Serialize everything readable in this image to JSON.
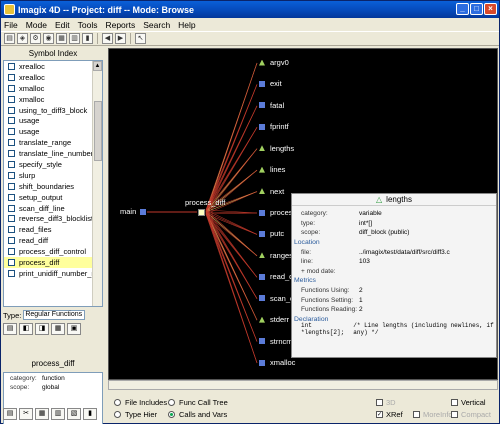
{
  "window": {
    "title": "Imagix 4D -- Project: diff -- Mode: Browse"
  },
  "menu": [
    "File",
    "Mode",
    "Edit",
    "Tools",
    "Reports",
    "Search",
    "Help"
  ],
  "symbol_index": {
    "header": "Symbol Index",
    "items": [
      "xrealloc",
      "xrealloc",
      "xmalloc",
      "xmalloc",
      "using_to_diff3_block",
      "usage",
      "usage",
      "translate_range",
      "translate_line_number",
      "specify_style",
      "slurp",
      "shift_boundaries",
      "setup_output",
      "scan_diff_line",
      "reverse_diff3_blocklist",
      "read_files",
      "read_diff",
      "process_diff_control",
      "process_diff",
      "print_unidiff_number_range"
    ],
    "selected_index": 18
  },
  "type_filter": {
    "label": "Type:",
    "value": "Regular Functions"
  },
  "info_panel": {
    "title": "process_diff",
    "rows": [
      {
        "k": "category:",
        "v": "function"
      },
      {
        "k": "scope:",
        "v": "global"
      }
    ]
  },
  "graph": {
    "root": "main",
    "center": "process_diff",
    "targets": [
      "argv0",
      "exit",
      "fatal",
      "fprintf",
      "lengths",
      "lines",
      "next",
      "process",
      "putc",
      "ranges",
      "read_d",
      "scan_d",
      "stderr",
      "strncmp",
      "xmalloc"
    ]
  },
  "popup": {
    "title": "lengths",
    "props": [
      {
        "k": "category:",
        "v": "variable"
      },
      {
        "k": "type:",
        "v": "int*[]"
      },
      {
        "k": "scope:",
        "v": "diff_block (public)"
      }
    ],
    "location_header": "Location",
    "location": [
      {
        "k": "file:",
        "v": "../imagix/test/data/diff/src/diff3.c"
      },
      {
        "k": "line:",
        "v": "103"
      },
      {
        "k": "+ mod date:",
        "v": ""
      }
    ],
    "metrics_header": "Metrics",
    "metrics": [
      {
        "k": "Functions Using:",
        "v": "2"
      },
      {
        "k": "Functions Setting:",
        "v": "1"
      },
      {
        "k": "Functions Reading:",
        "v": "2"
      }
    ],
    "decl_header": "Declaration",
    "decl_code": "int *lengths[2];",
    "decl_comment": "/* Line lengths (including newlines, if any) */"
  },
  "bottom": {
    "file_includes": "File Includes",
    "type_hier": "Type Hier",
    "func_call_tree": "Func Call Tree",
    "calls_and_vars": "Calls and Vars",
    "opt_3d": "3D",
    "opt_vertical": "Vertical",
    "opt_xref": "XRef",
    "opt_moreinfo": "MoreInfo",
    "opt_compact": "Compact"
  },
  "colors": {
    "canvas": "#000000",
    "call_edge": "#c0392b",
    "var_edge": "#f0c060",
    "node": "#5b7bd8",
    "var_node": "#a0d060"
  }
}
